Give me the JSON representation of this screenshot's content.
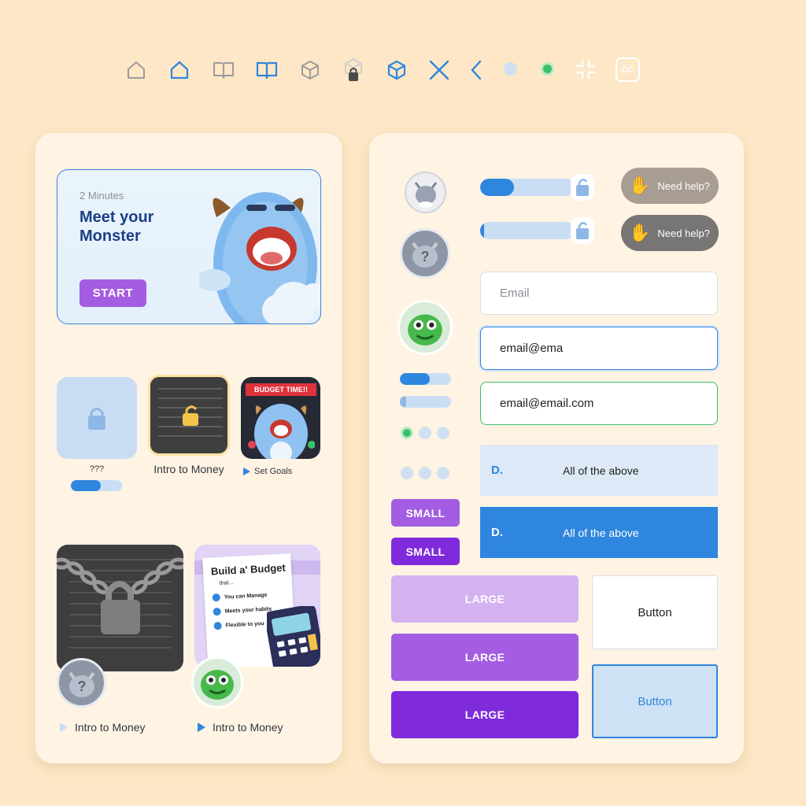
{
  "icon_row": [
    {
      "name": "home-outline-icon"
    },
    {
      "name": "home-active-icon"
    },
    {
      "name": "book-outline-icon"
    },
    {
      "name": "book-active-icon"
    },
    {
      "name": "cube-outline-icon"
    },
    {
      "name": "cube-locked-icon"
    },
    {
      "name": "cube-active-icon"
    },
    {
      "name": "close-icon"
    },
    {
      "name": "chevron-left-icon"
    },
    {
      "name": "dot-inactive-icon"
    },
    {
      "name": "dot-active-icon"
    },
    {
      "name": "collapse-icon"
    },
    {
      "name": "closed-captions-icon",
      "label": "CC"
    }
  ],
  "left_panel": {
    "hero": {
      "duration": "2 Minutes",
      "title": "Meet your Monster",
      "button": "START"
    },
    "tiles": {
      "locked": {
        "caption": "???",
        "progress": 0.58
      },
      "intro": {
        "caption": "Intro to Money"
      },
      "budget": {
        "banner": "BUDGET TIME!!",
        "caption": "Set Goals"
      }
    },
    "big_tiles": {
      "chained": {
        "caption": "Intro to Money"
      },
      "budget_sheet": {
        "heading": "Build a' Budget",
        "sub": "that...",
        "items": [
          "You can Manage",
          "Meets your habits",
          "Flexible to you"
        ],
        "caption": "Intro to Money"
      }
    }
  },
  "right_panel": {
    "help_label": "Need help?",
    "progress_top": 0.36,
    "email_placeholder": "Email",
    "email_typing": "email@ema",
    "email_valid": "email@email.com",
    "answer_letter": "D.",
    "answer_text": "All of the above",
    "small_label": "SMALL",
    "large_label": "LARGE",
    "button_label": "Button",
    "colors": {
      "purple_light": "#d4b2f1",
      "purple": "#a45de2",
      "purple_dark": "#7f2bdc",
      "blue": "#2f86de",
      "green": "#3cbf6b"
    }
  }
}
